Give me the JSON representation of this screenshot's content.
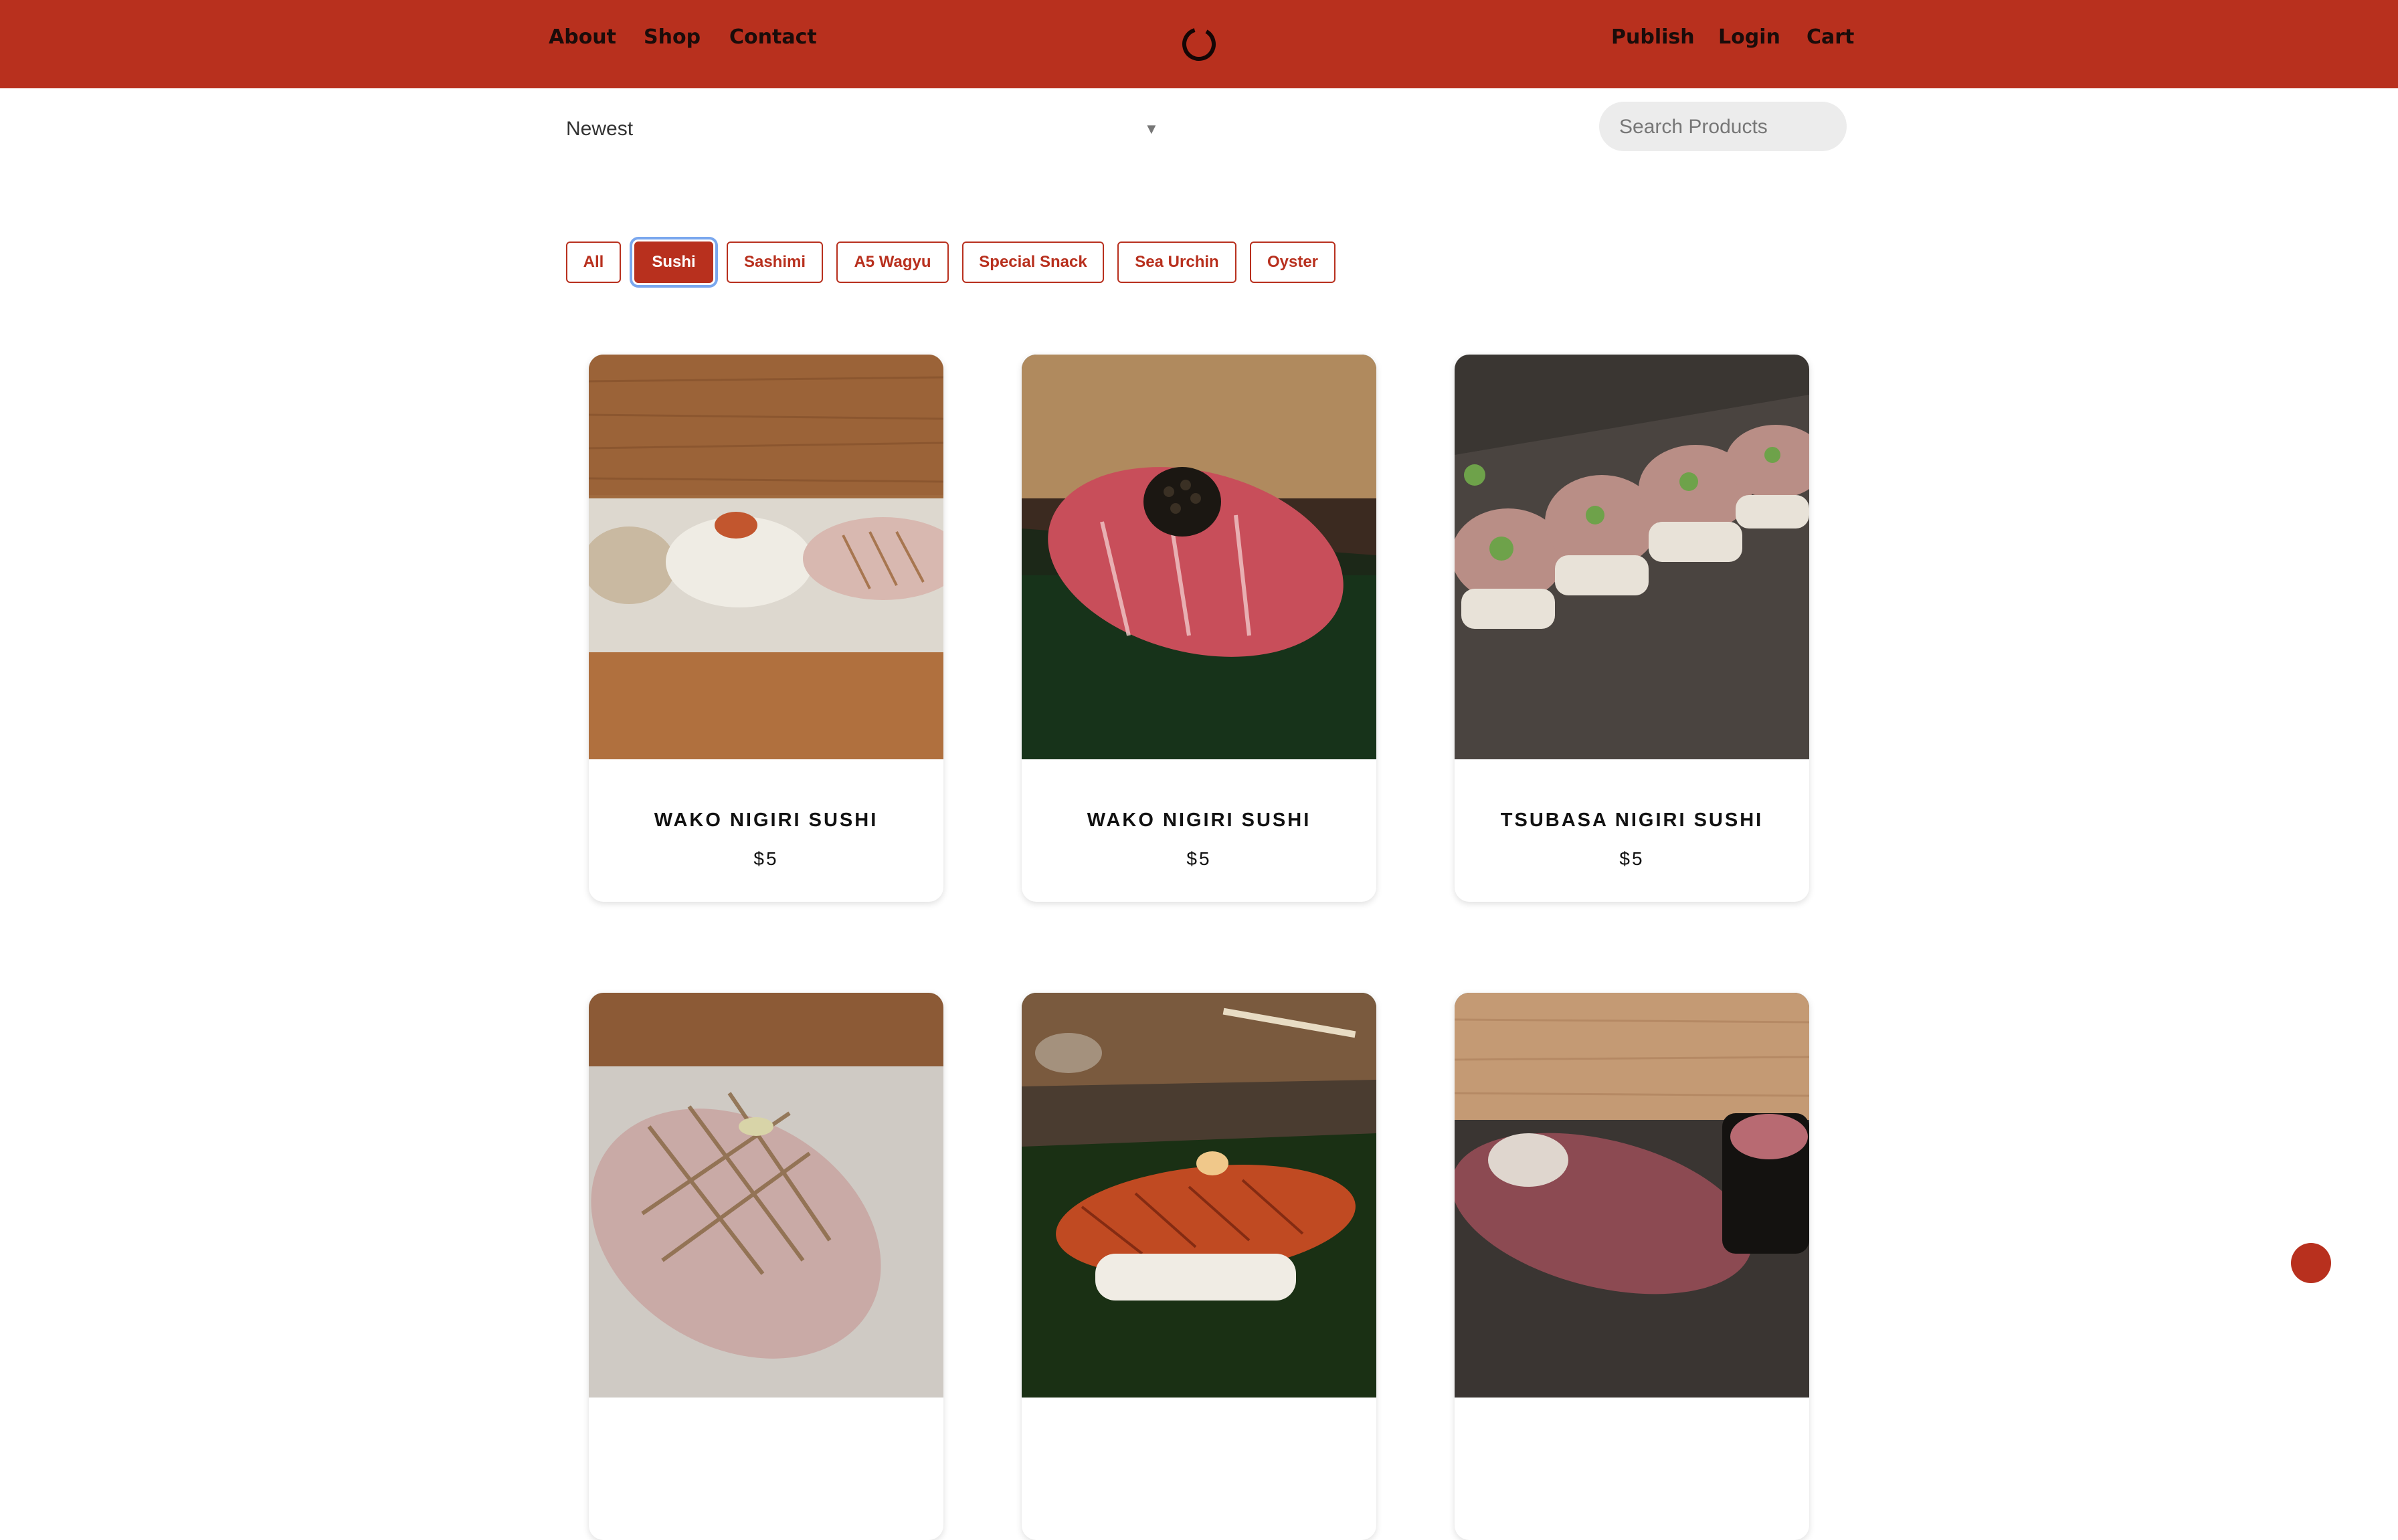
{
  "brand": {
    "accent": "#b8301e",
    "logo_icon": "ring-logo-icon"
  },
  "nav": {
    "left": [
      "About",
      "Shop",
      "Contact"
    ],
    "right": [
      "Publish",
      "Login",
      "Cart"
    ]
  },
  "sort": {
    "selected": "Newest"
  },
  "search": {
    "placeholder": "Search Products",
    "value": ""
  },
  "filters": {
    "items": [
      "All",
      "Sushi",
      "Sashimi",
      "A5 Wagyu",
      "Special Snack",
      "Sea Urchin",
      "Oyster"
    ],
    "active": "Sushi"
  },
  "products": [
    {
      "name": "WAKO NIGIRI SUSHI",
      "price": "$5",
      "image": "sushi-plate-three-nigiri-photo"
    },
    {
      "name": "WAKO NIGIRI SUSHI",
      "price": "$5",
      "image": "otoro-nigiri-with-caviar-photo"
    },
    {
      "name": "TSUBASA NIGIRI SUSHI",
      "price": "$5",
      "image": "seared-pressed-sushi-photo"
    },
    {
      "name": "",
      "price": "",
      "image": "scored-mackerel-nigiri-photo"
    },
    {
      "name": "",
      "price": "",
      "image": "seared-kinmedai-nigiri-photo"
    },
    {
      "name": "",
      "price": "",
      "image": "seared-tuna-nigiri-photo"
    }
  ],
  "chat_button": {
    "icon": "chat-bubble-icon"
  }
}
